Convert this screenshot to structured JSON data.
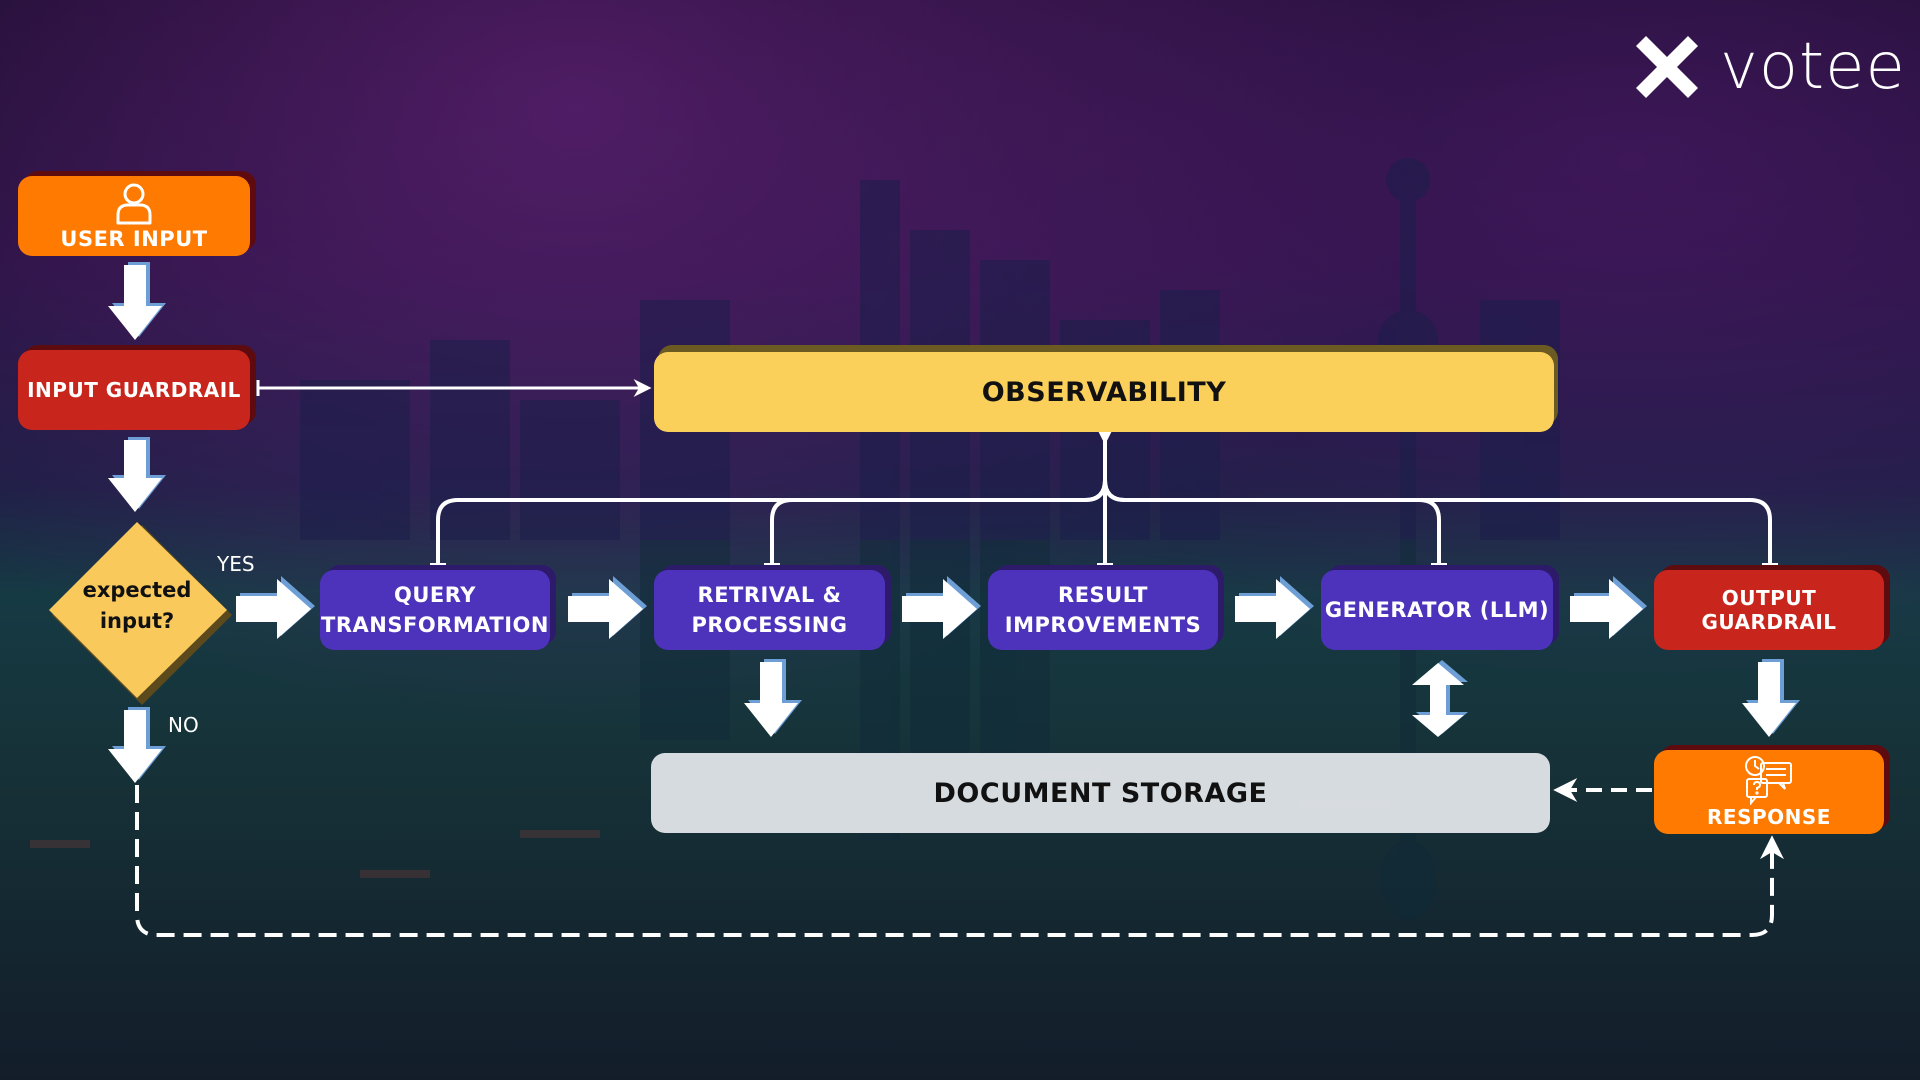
{
  "brand": {
    "name": "votee",
    "logo_icon": "x-mark-icon"
  },
  "nodes": {
    "user_input": {
      "label": "USER INPUT",
      "icon": "user-icon",
      "color": "#ff7a00"
    },
    "input_guardrail": {
      "label": "INPUT GUARDRAIL",
      "color": "#c8261c"
    },
    "decision": {
      "line1": "expected",
      "line2": "input?",
      "color": "#fbd05a"
    },
    "observability": {
      "label": "OBSERVABILITY",
      "color": "#fbd05a"
    },
    "query_transformation": {
      "line1": "QUERY",
      "line2": "TRANSFORMATION",
      "color": "#4d33bb"
    },
    "retrieval_processing": {
      "line1": "RETRIVAL &",
      "line2": "PROCESSING",
      "color": "#4d33bb"
    },
    "result_improvements": {
      "line1": "RESULT",
      "line2": "IMPROVEMENTS",
      "color": "#4d33bb"
    },
    "generator": {
      "label": "GENERATOR (LLM)",
      "color": "#4d33bb"
    },
    "output_guardrail": {
      "label": "OUTPUT GUARDRAIL",
      "color": "#c8261c"
    },
    "document_storage": {
      "label": "DOCUMENT STORAGE",
      "color": "#e4e8ec"
    },
    "response": {
      "label": "RESPONSE",
      "icon": "chat-question-clock-icon",
      "color": "#ff7a00"
    }
  },
  "edge_labels": {
    "yes": "YES",
    "no": "NO"
  },
  "edges": [
    {
      "from": "user_input",
      "to": "input_guardrail",
      "style": "block-arrow"
    },
    {
      "from": "input_guardrail",
      "to": "decision",
      "style": "block-arrow"
    },
    {
      "from": "input_guardrail",
      "to": "observability",
      "style": "line-arrow"
    },
    {
      "from": "decision",
      "to": "query_transformation",
      "style": "block-arrow",
      "label": "YES"
    },
    {
      "from": "query_transformation",
      "to": "retrieval_processing",
      "style": "block-arrow"
    },
    {
      "from": "retrieval_processing",
      "to": "result_improvements",
      "style": "block-arrow"
    },
    {
      "from": "result_improvements",
      "to": "generator",
      "style": "block-arrow"
    },
    {
      "from": "generator",
      "to": "output_guardrail",
      "style": "block-arrow"
    },
    {
      "from": "retrieval_processing",
      "to": "document_storage",
      "style": "block-arrow"
    },
    {
      "from": "generator",
      "to": "document_storage",
      "style": "double-block-arrow"
    },
    {
      "from": "output_guardrail",
      "to": "response",
      "style": "block-arrow"
    },
    {
      "from": "response",
      "to": "document_storage",
      "style": "dashed-arrow"
    },
    {
      "from": "decision",
      "to": "response",
      "style": "dashed-arrow",
      "label": "NO"
    },
    {
      "from": "query_transformation",
      "to": "observability",
      "style": "tree-line"
    },
    {
      "from": "retrieval_processing",
      "to": "observability",
      "style": "tree-line"
    },
    {
      "from": "result_improvements",
      "to": "observability",
      "style": "tree-line"
    },
    {
      "from": "generator",
      "to": "observability",
      "style": "tree-line"
    },
    {
      "from": "output_guardrail",
      "to": "observability",
      "style": "tree-line"
    }
  ]
}
